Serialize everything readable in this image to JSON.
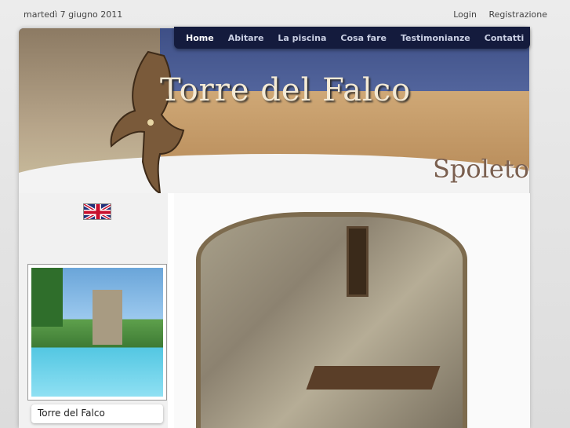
{
  "topbar": {
    "date": "martedì 7 giugno 2011",
    "login": "Login",
    "register": "Registrazione"
  },
  "nav": {
    "items": [
      "Home",
      "Abitare",
      "La piscina",
      "Cosa fare",
      "Testimonianze",
      "Contatti"
    ],
    "active_index": 0
  },
  "header": {
    "title": "Torre del Falco",
    "subtitle": "Spoleto"
  },
  "sidebar": {
    "flag_icon": "uk-flag-icon",
    "caption": "Torre del Falco"
  },
  "colors": {
    "nav_bg": "#141b3d",
    "header_sky": "#5b6ea6",
    "page_bg": "#e6e6e6"
  }
}
